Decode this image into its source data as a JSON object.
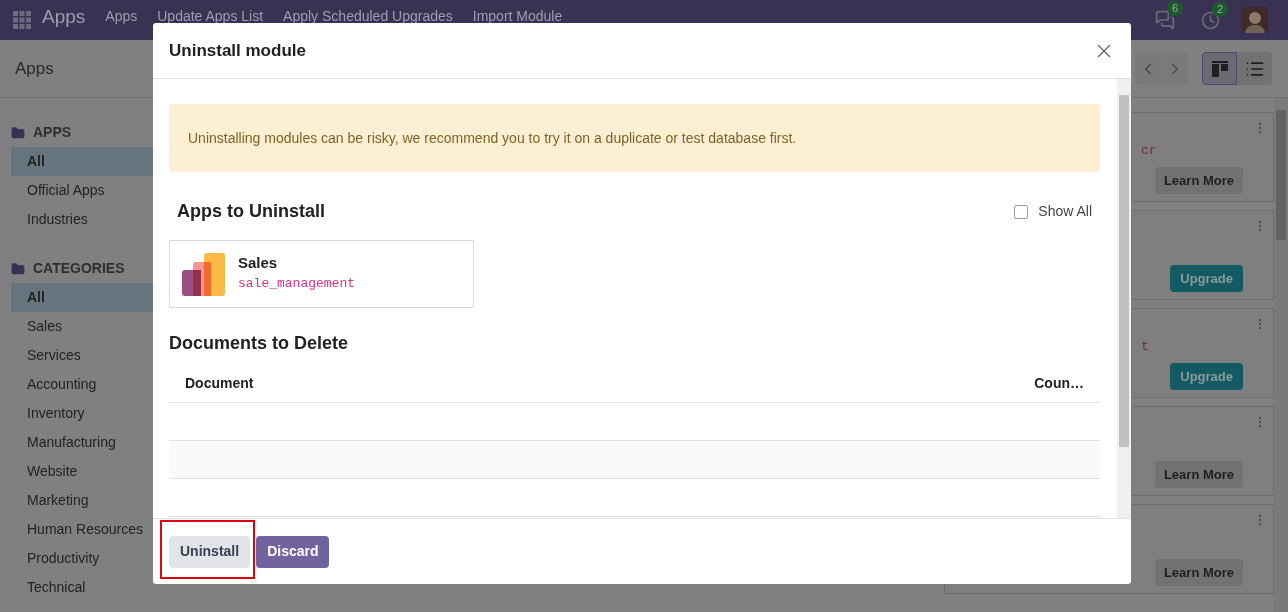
{
  "navbar": {
    "brand": "Apps",
    "menu": [
      "Apps",
      "Update Apps List",
      "Apply Scheduled Upgrades",
      "Import Module"
    ],
    "messages_badge": "6",
    "activities_badge": "2"
  },
  "control_panel": {
    "breadcrumb": "Apps",
    "views": [
      {
        "kind": "kanban",
        "selected": true
      },
      {
        "kind": "list",
        "selected": false
      }
    ]
  },
  "sidebar": {
    "sections": [
      {
        "title": "APPS",
        "items": [
          {
            "label": "All",
            "selected": true
          },
          {
            "label": "Official Apps",
            "selected": false
          },
          {
            "label": "Industries",
            "selected": false
          }
        ]
      },
      {
        "title": "CATEGORIES",
        "items": [
          {
            "label": "All",
            "selected": true
          },
          {
            "label": "Sales",
            "selected": false
          },
          {
            "label": "Services",
            "selected": false
          },
          {
            "label": "Accounting",
            "selected": false
          },
          {
            "label": "Inventory",
            "selected": false
          },
          {
            "label": "Manufacturing",
            "selected": false
          },
          {
            "label": "Website",
            "selected": false
          },
          {
            "label": "Marketing",
            "selected": false
          },
          {
            "label": "Human Resources",
            "selected": false
          },
          {
            "label": "Productivity",
            "selected": false
          },
          {
            "label": "Technical",
            "selected": false
          }
        ]
      }
    ]
  },
  "cards": [
    {
      "fragment": "cr",
      "button": {
        "label": "Learn More",
        "kind": "learn"
      }
    },
    {
      "button": {
        "label": "Upgrade",
        "kind": "upgrade"
      }
    },
    {
      "fragment": "t",
      "button": {
        "label": "Upgrade",
        "kind": "upgrade"
      }
    },
    {
      "button": {
        "label": "Learn More",
        "kind": "learn"
      }
    },
    {
      "button": {
        "label": "Learn More",
        "kind": "learn"
      }
    }
  ],
  "dialog": {
    "title": "Uninstall module",
    "alert": "Uninstalling modules can be risky, we recommend you to try it on a duplicate or test database first.",
    "apps_heading": "Apps to Uninstall",
    "show_all": {
      "label": "Show All",
      "checked": false
    },
    "apps": [
      {
        "name": "Sales",
        "technical_name": "sale_management"
      }
    ],
    "documents_heading": "Documents to Delete",
    "columns": [
      "Document",
      "Coun…"
    ],
    "buttons": [
      {
        "label": "Uninstall",
        "kind": "secondary"
      },
      {
        "label": "Discard",
        "kind": "primary"
      }
    ]
  }
}
